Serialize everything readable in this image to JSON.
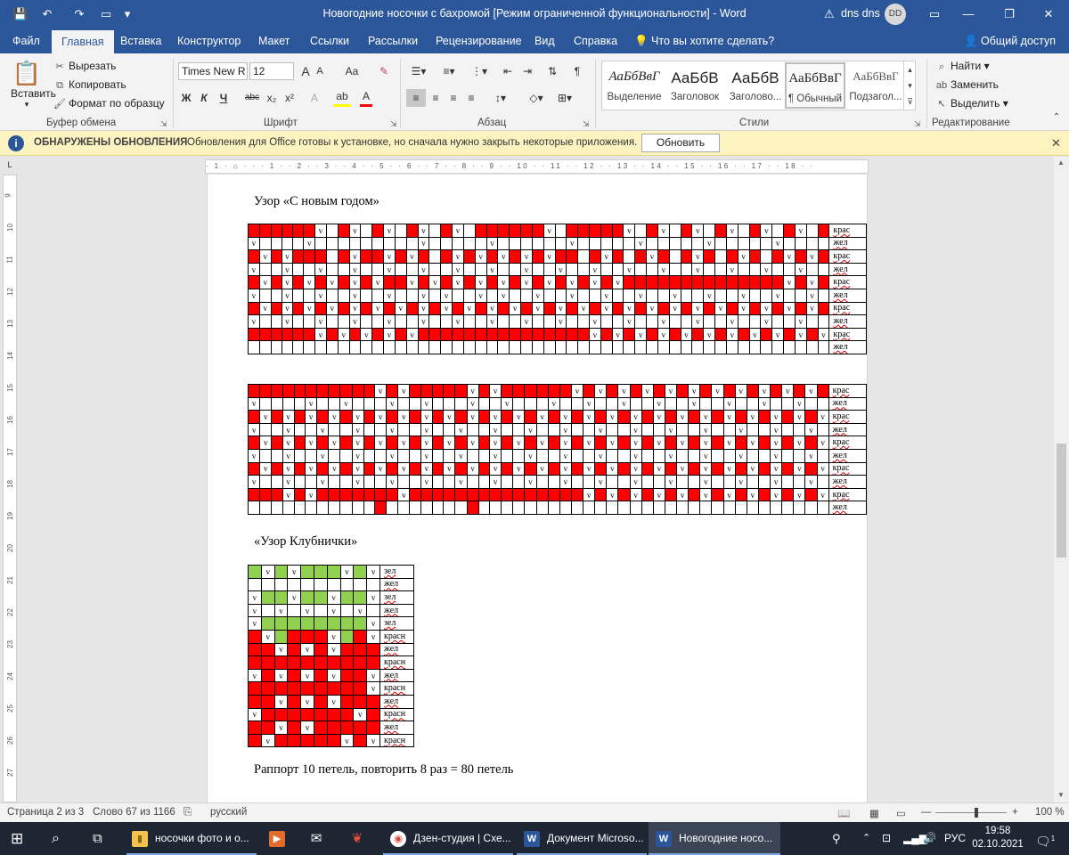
{
  "window": {
    "title": "Новогодние носочки  с бахромой [Режим ограниченной функциональности]  -  Word",
    "user_name": "dns dns",
    "user_initials": "DD",
    "warning_icon": "⚠",
    "minimize": "—",
    "maximize": "☐",
    "restore": "❐",
    "close": "✕"
  },
  "quick_access": {
    "save": "💾",
    "undo": "↶",
    "redo": "↷",
    "new": "▭",
    "customize": "▾"
  },
  "tabs": [
    "Файл",
    "Главная",
    "Вставка",
    "Конструктор",
    "Макет",
    "Ссылки",
    "Рассылки",
    "Рецензирование",
    "Вид",
    "Справка"
  ],
  "tell_me": "Что вы хотите сделать?",
  "share": "Общий доступ",
  "clipboard": {
    "paste": "Вставить",
    "cut": "Вырезать",
    "copy": "Копировать",
    "format_painter": "Формат по образцу",
    "label": "Буфер обмена"
  },
  "font": {
    "name": "Times New R",
    "size": "12",
    "grow": "A",
    "shrink": "A",
    "case": "Aa",
    "bold": "Ж",
    "italic": "К",
    "underline": "Ч",
    "strike": "abc",
    "sub": "x₂",
    "sup": "x²",
    "label": "Шрифт"
  },
  "paragraph": {
    "label": "Абзац"
  },
  "styles": {
    "items": [
      {
        "preview": "АаБбВвГ",
        "name": "Выделение"
      },
      {
        "preview": "АаБбВ",
        "name": "Заголовок"
      },
      {
        "preview": "АаБбВ",
        "name": "Заголово..."
      },
      {
        "preview": "АаБбВвГ",
        "name": "¶ Обычный"
      },
      {
        "preview": "АаБбВвГ",
        "name": "Подзагол..."
      }
    ],
    "label": "Стили"
  },
  "editing": {
    "find": "Найти",
    "replace": "Заменить",
    "select": "Выделить",
    "label": "Редактирование"
  },
  "update_bar": {
    "icon": "i",
    "title": "ОБНАРУЖЕНЫ ОБНОВЛЕНИЯ",
    "message": "Обновления для Office готовы к установке, но сначала нужно закрыть некоторые приложения.",
    "button": "Обновить",
    "close": "✕"
  },
  "ruler": {
    "text": "· 1 · ⌂ · · · 1 · · 2 · · 3 · · 4 · · 5 · · 6 · · 7 · · 8 · · 9 · · 10 · · 11 · · 12 · · 13 · · 14 · · 15 · · 16 · · 17 · · 18 · ·",
    "corner": "L",
    "vnums": [
      "9",
      "10",
      "11",
      "12",
      "13",
      "14",
      "15",
      "16",
      "17",
      "18",
      "19",
      "20",
      "21",
      "22",
      "23",
      "24",
      "25",
      "26",
      "27"
    ]
  },
  "document": {
    "heading1": "Узор «С новым годом»",
    "heading2": "«Узор Клубнички»",
    "footer_text": "Раппорт 10 петель, повторить 8 раз = 80 петель",
    "grids": [
      {
        "rows": [
          "RRRRRRv.Rv.Rv.Rv.Rv.RRRRRRv.RRRRRv.Rv.Rv.Rv.Rv.Rv.R",
          "v....v.........v.....v......v.....v.....v.....v....",
          "RvRvRRR.RvRRvRvR.RvRvRvRvRvRR.RvR.RvR.RvR.RvR.RvRvR",
          "v..v..v..v..v..v..v..v..v..v..v..v..v..v..v..v..v.",
          "RvRvRvRvRvRvRRvRvRvRvRvRvRvRvRvRvRRRRRRRRRRRRRRvRvR",
          "v..v..v..v..v..v.v..v.v..v..v..v..v..v..v..v..v..v.",
          "RvRvRvRvRvRvRvRvRvRvRvRvRvRvRvRvRvRvRvRvRvRvRvRvRvR",
          "v..v..v..v..v..v..v..v..v..v..v..v..v..v..v..v..v..",
          "RRRRRRvRvRvRvRvRRRRRRRRRRRRRRRvRvRvRvRvRvRvRvRvRvRv",
          ".................................................."
        ],
        "labels": [
          "крас",
          "жел",
          "крас",
          "жел",
          "крас",
          "жел",
          "крас",
          "жел",
          "крас",
          "жел"
        ]
      },
      {
        "rows": [
          "RRRRRRRRRRRvRvRRRRRvRvRRRRRRvRvRvRvRvRvRvRvRvRvRvR",
          "v....v..v...v..v...v..v...v..v..v..v..v..v..v..v..",
          "RvRvRvRvRvRvRvRvRvRvRvRvRvRvRvRvRvRvRvRvRvRvRvRvRv",
          "v..v..v..v..v..v..v..v..v..v..v..v..v..v..v..v..v.",
          "RvRvRvRvRvRvRvRvRvRvRvRvRvRvRvRvRvRvRvRvRvRvRvRvRv",
          "v..v..v..v..v..v..v..v..v..v..v..v..v..v..v..v..v.",
          "RvRvRvRvRvRvRvRvRvRvRvRvRvRvRvRvRvRvRvRvRvRvRvRvRv",
          "v..v..v..v..v..v..v..v..v..v..v..v..v..v..v..v..v.",
          "RRRvRvRRRRRRRvRRRRRRRRRRRRRRRvRvRvRvRvRvRvRvRvRvRv",
          "...........R.......R.............................."
        ],
        "labels": [
          "крас",
          "жел",
          "крас",
          "жел",
          "крас",
          "жел",
          "крас",
          "жел",
          "крас",
          "жел"
        ]
      },
      {
        "rows": [
          "GvGvGGGvGv",
          "..........",
          "vGGvGGvGGv",
          "v.v.v.v.v.",
          "vGGGGGGGGv",
          "RvGRRRvGRv",
          "RRvRvRvRRR",
          "RRRRRRRRRR",
          "vRvRvRvRRv",
          "RRRRRRRRRv",
          "RRvRvRvRRR",
          "vRRRRRRRvR",
          "RRvRvRRRRR",
          "RvRRRRRvRv"
        ],
        "labels": [
          "зел",
          "жел",
          "зел",
          "жел",
          "зел",
          "красн",
          "жел",
          "красн",
          "жел",
          "красн",
          "жел",
          "красн",
          "жел",
          "красн"
        ]
      }
    ]
  },
  "status": {
    "page": "Страница 2 из 3",
    "words": "Слово 67 из 1166",
    "lang": "русский",
    "zoom": "100 %"
  },
  "taskbar": {
    "items": [
      {
        "label": "носочки фото и о...",
        "icon": "▮"
      },
      {
        "label": "Дзен-студия | Схе...",
        "icon": "◉"
      },
      {
        "label": "Документ Microso...",
        "icon": "W"
      },
      {
        "label": "Новогодние носо...",
        "icon": "W"
      }
    ],
    "lang": "РУС",
    "time": "19:58",
    "date": "02.10.2021",
    "notifications": "1"
  },
  "colors": {
    "red": "#ff0000",
    "green": "#92d050",
    "word_blue": "#2b579a"
  }
}
